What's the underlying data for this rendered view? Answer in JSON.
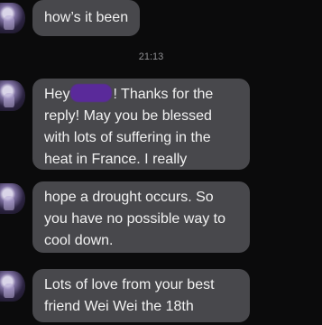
{
  "messages": [
    {
      "text": "how’s it been"
    },
    {
      "text_before": "Hey",
      "text_after": "! Thanks for the reply! May you be blessed with lots of suffering in the heat in France. I really"
    },
    {
      "text": "hope a drought occurs. So you have no possible way to cool down."
    },
    {
      "text": "Lots of love from your best friend Wei Wei the 18th"
    }
  ],
  "timestamp": "21:13",
  "colors": {
    "background": "#0b0b0c",
    "bubble": "#48484c",
    "timestamp": "#8f8f93",
    "redaction": "#5a2a9a"
  }
}
